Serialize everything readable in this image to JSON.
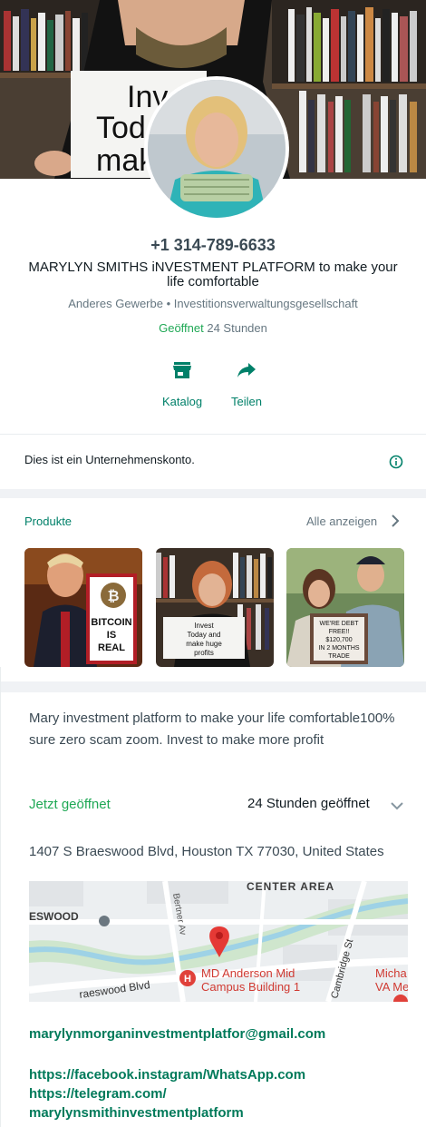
{
  "cover": {
    "sign_lines": [
      "Inv",
      "Tod",
      "mak"
    ]
  },
  "profile": {
    "phone": "+1 314-789-6633",
    "name": "MARYLYN SMITHS iNVESTMENT PLATFORM to make your life comfortable",
    "category": "Anderes Gewerbe • Investitionsverwaltungsgesellschaft",
    "hours_status_open": "Geöffnet",
    "hours_status_rest": " 24 Stunden"
  },
  "actions": [
    {
      "label": "Katalog",
      "icon": "storefront-icon"
    },
    {
      "label": "Teilen",
      "icon": "share-icon"
    }
  ],
  "business_notice": "Dies ist ein Unternehmenskonto.",
  "products": {
    "title": "Produkte",
    "see_all": "Alle anzeigen",
    "items": [
      {
        "caption_lines": [
          "BITCOIN",
          "IS",
          "REAL"
        ]
      },
      {
        "caption_lines": [
          "Invest",
          "Today and",
          "make huge",
          "profits"
        ]
      },
      {
        "caption_lines": [
          "WE'RE DEBT",
          "FREE!!",
          "$120,700",
          "IN 2 MONTHS",
          "TRADE"
        ]
      }
    ]
  },
  "about": {
    "description": "Mary investment platform to make your life comfortable100% sure zero scam zoom. Invest to make more profit",
    "now_open": "Jetzt geöffnet",
    "hours": "24 Stunden geöffnet",
    "address": "1407 S Braeswood Blvd, Houston TX 77030, United States"
  },
  "map": {
    "labels": {
      "center_area": "CENTER AREA",
      "eswood": "ESWOOD",
      "bertner": "Bertner Av",
      "braeswood": "raeswood Blvd",
      "md_anderson_1": "MD Anderson Mid",
      "md_anderson_2": "Campus Building 1",
      "cambridge": "Cambridge St",
      "micha_1": "Micha",
      "micha_2": "VA Me"
    }
  },
  "links": {
    "email": "marylynmorganinvestmentplatfor@gmail.com",
    "facebook": "https://facebook.instagram/WhatsApp.com",
    "telegram_1": "https://telegram.com/",
    "telegram_2": "marylynsmithinvestmentplatform"
  },
  "colors": {
    "accent": "#008069",
    "open_green": "#1fa855",
    "secondary_text": "#667781"
  }
}
